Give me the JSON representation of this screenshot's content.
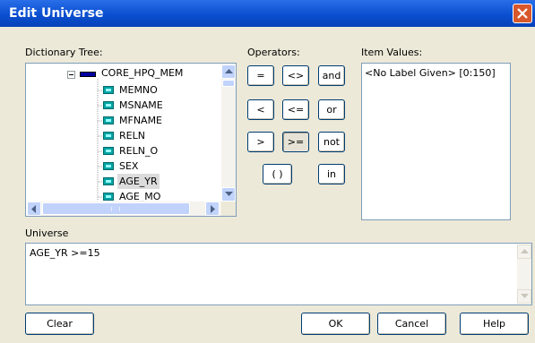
{
  "window": {
    "title": "Edit Universe"
  },
  "dictionary_tree": {
    "label": "Dictionary Tree:",
    "root": {
      "name": "CORE_HPQ_MEM",
      "expander": "-"
    },
    "items": [
      "MEMNO",
      "MSNAME",
      "MFNAME",
      "RELN",
      "RELN_O",
      "SEX",
      "AGE_YR",
      "AGE_MO"
    ],
    "selected": "AGE_YR"
  },
  "operators": {
    "label": "Operators:",
    "buttons": [
      "=",
      "<>",
      "and",
      "<",
      "<=",
      "or",
      ">",
      ">=",
      "not",
      "( )",
      "in"
    ],
    "pressed": ">="
  },
  "item_values": {
    "label": "Item Values:",
    "items": [
      "<No Label Given> [0:150]"
    ]
  },
  "universe": {
    "label": "Universe",
    "expression": "AGE_YR >=15"
  },
  "footer": {
    "clear": "Clear",
    "ok": "OK",
    "cancel": "Cancel",
    "help": "Help"
  }
}
